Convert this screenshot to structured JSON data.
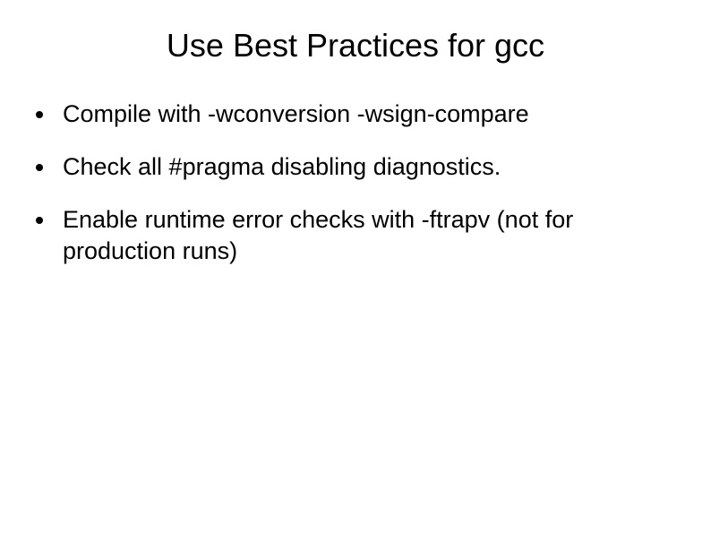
{
  "title": "Use Best Practices for gcc",
  "bullets": [
    {
      "text": "Compile with -wconversion -wsign-compare"
    },
    {
      "text": "Check all #pragma disabling diagnostics."
    },
    {
      "text": "Enable runtime error checks with -ftrapv (not for production runs)"
    }
  ]
}
